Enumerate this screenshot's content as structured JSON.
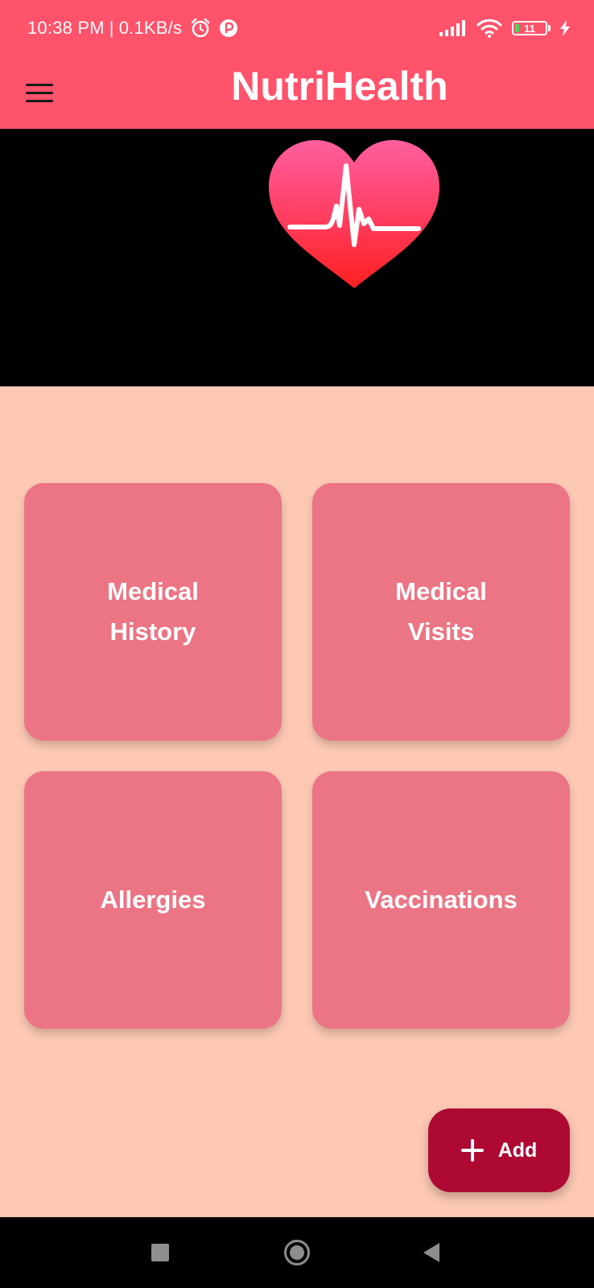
{
  "status_bar": {
    "time": "10:38 PM",
    "separator": "|",
    "network_speed": "0.1KB/s",
    "battery_level": "11",
    "icons": [
      "alarm-icon",
      "app-notification-icon",
      "signal-icon",
      "wifi-icon",
      "battery-icon",
      "charging-icon"
    ]
  },
  "app_bar": {
    "title": "NutriHealth",
    "menu_icon": "hamburger-menu-icon"
  },
  "hero": {
    "logo": "heart-pulse-logo"
  },
  "cards": [
    {
      "label": "Medical\nHistory"
    },
    {
      "label": "Medical\nVisits"
    },
    {
      "label": "Allergies"
    },
    {
      "label": "Vaccinations"
    }
  ],
  "fab": {
    "label": "Add",
    "icon": "plus-icon"
  },
  "nav_bar": {
    "icons": [
      "recents-icon",
      "home-icon",
      "back-icon"
    ]
  },
  "colors": {
    "primary": "#FF526B",
    "background": "#FDC9B5",
    "card": "#EC7585",
    "fab": "#AE0932",
    "hero_background": "#000000"
  }
}
